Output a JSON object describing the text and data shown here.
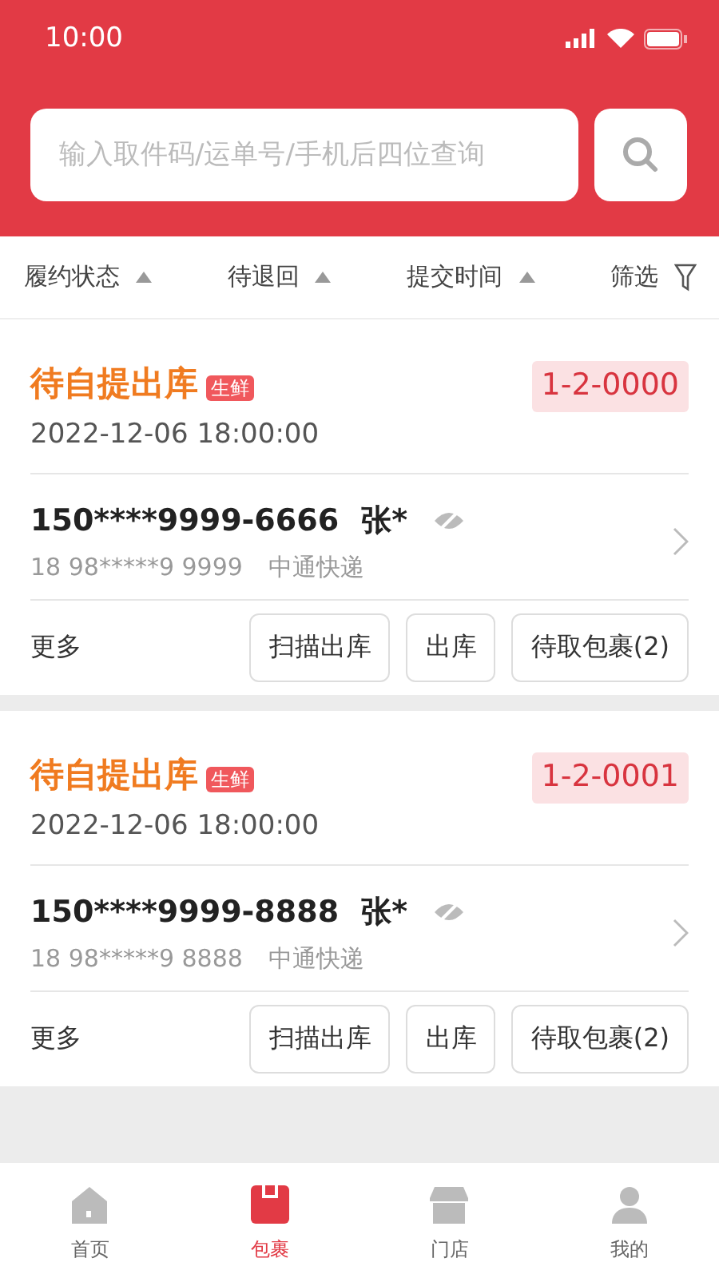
{
  "status_bar": {
    "time": "10:00"
  },
  "search": {
    "placeholder": "输入取件码/运单号/手机后四位查询"
  },
  "filters": [
    {
      "label": "履约状态",
      "kind": "sort"
    },
    {
      "label": "待退回",
      "kind": "sort"
    },
    {
      "label": "提交时间",
      "kind": "sort"
    },
    {
      "label": "筛选",
      "kind": "filter"
    }
  ],
  "parcels": [
    {
      "status": "待自提出库",
      "tag": "生鲜",
      "code": "1-2-0000",
      "time": "2022-12-06 18:00:00",
      "phone": "150****9999-6666",
      "name": "张*",
      "tracking": "18 98*****9 9999",
      "courier": "中通快递",
      "more": "更多",
      "actions": [
        "扫描出库",
        "出库",
        "待取包裹(2)"
      ]
    },
    {
      "status": "待自提出库",
      "tag": "生鲜",
      "code": "1-2-0001",
      "time": "2022-12-06 18:00:00",
      "phone": "150****9999-8888",
      "name": "张*",
      "tracking": "18 98*****9 8888",
      "courier": "中通快递",
      "more": "更多",
      "actions": [
        "扫描出库",
        "出库",
        "待取包裹(2)"
      ]
    }
  ],
  "tab_bar": [
    {
      "label": "首页",
      "kind": "home",
      "selected": false
    },
    {
      "label": "包裹",
      "kind": "parcel",
      "selected": true
    },
    {
      "label": "门店",
      "kind": "store",
      "selected": false
    },
    {
      "label": "我的",
      "kind": "profile",
      "selected": false
    }
  ]
}
